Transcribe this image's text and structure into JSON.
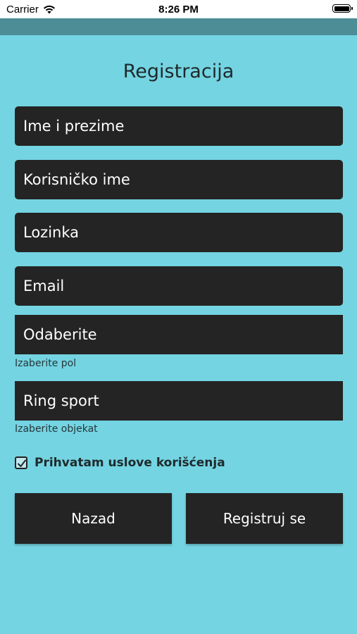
{
  "status_bar": {
    "carrier": "Carrier",
    "time": "8:26 PM"
  },
  "page": {
    "title": "Registracija"
  },
  "fields": {
    "full_name": "Ime i prezime",
    "username": "Korisničko ime",
    "password": "Lozinka",
    "email": "Email",
    "gender_value": "Odaberite",
    "gender_helper": "Izaberite pol",
    "facility_value": "Ring sport",
    "facility_helper": "Izaberite objekat"
  },
  "terms": {
    "label": "Prihvatam uslove korišćenja",
    "checked": true
  },
  "buttons": {
    "back": "Nazad",
    "register": "Registruj se"
  },
  "colors": {
    "background": "#74d4e2",
    "nav_bar": "#4d8d96",
    "field": "#242424"
  }
}
